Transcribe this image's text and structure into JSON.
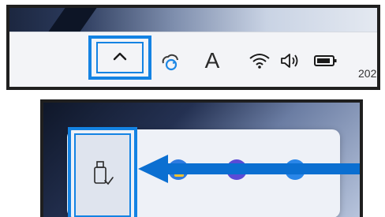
{
  "taskbar": {
    "show_hidden_icons_label": "^",
    "ime_indicator": "A",
    "clock_partial": "202",
    "icons": {
      "chevron": "chevron-up-icon",
      "weather": "weather-sync-icon",
      "wifi": "wifi-icon",
      "speaker": "speaker-icon",
      "battery": "battery-icon"
    }
  },
  "flyout": {
    "highlighted_icon": "usb-safely-remove-icon",
    "other_icons": [
      "app-icon-1",
      "app-icon-2",
      "app-icon-3"
    ]
  },
  "annotation": {
    "highlight_color": "#1483e3",
    "arrow_color": "#0b6fd1"
  }
}
